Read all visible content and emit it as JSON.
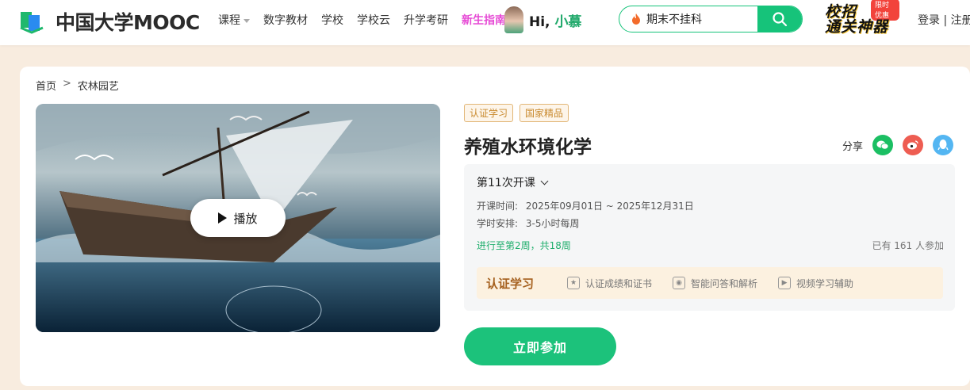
{
  "header": {
    "logo_text": "中国大学MOOC",
    "nav": [
      {
        "label": "课程"
      },
      {
        "label": "数字教材"
      },
      {
        "label": "学校"
      },
      {
        "label": "学校云"
      },
      {
        "label": "升学考研"
      },
      {
        "label": "新生指南"
      }
    ],
    "hi_prefix": "Hi,",
    "hi_name": "小慕",
    "search_value": "期末不挂科",
    "promo_tag": "限时优惠",
    "promo_text": "校招通关神器",
    "auth_label": "登录 | 注册"
  },
  "breadcrumb": {
    "home": "首页",
    "separator": ">",
    "category": "农林园艺"
  },
  "video": {
    "play_label": "播放"
  },
  "course": {
    "tags": [
      "认证学习",
      "国家精品"
    ],
    "title": "养殖水环境化学",
    "share_label": "分享",
    "session_label": "第11次开课",
    "time_label": "开课时间:",
    "time_value": "2025年09月01日 ~ 2025年12月31日",
    "schedule_label": "学时安排:",
    "schedule_value": "3-5小时每周",
    "progress_text": "进行至第2周，共18周",
    "joined_text": "已有 161 人参加",
    "cert_title": "认证学习",
    "cert_items": [
      "认证成绩和证书",
      "智能问答和解析",
      "视频学习辅助"
    ],
    "join_button": "立即参加"
  },
  "colors": {
    "accent": "#1cc27b",
    "highlight": "#e64ad5",
    "tag": "#c98a2f"
  }
}
